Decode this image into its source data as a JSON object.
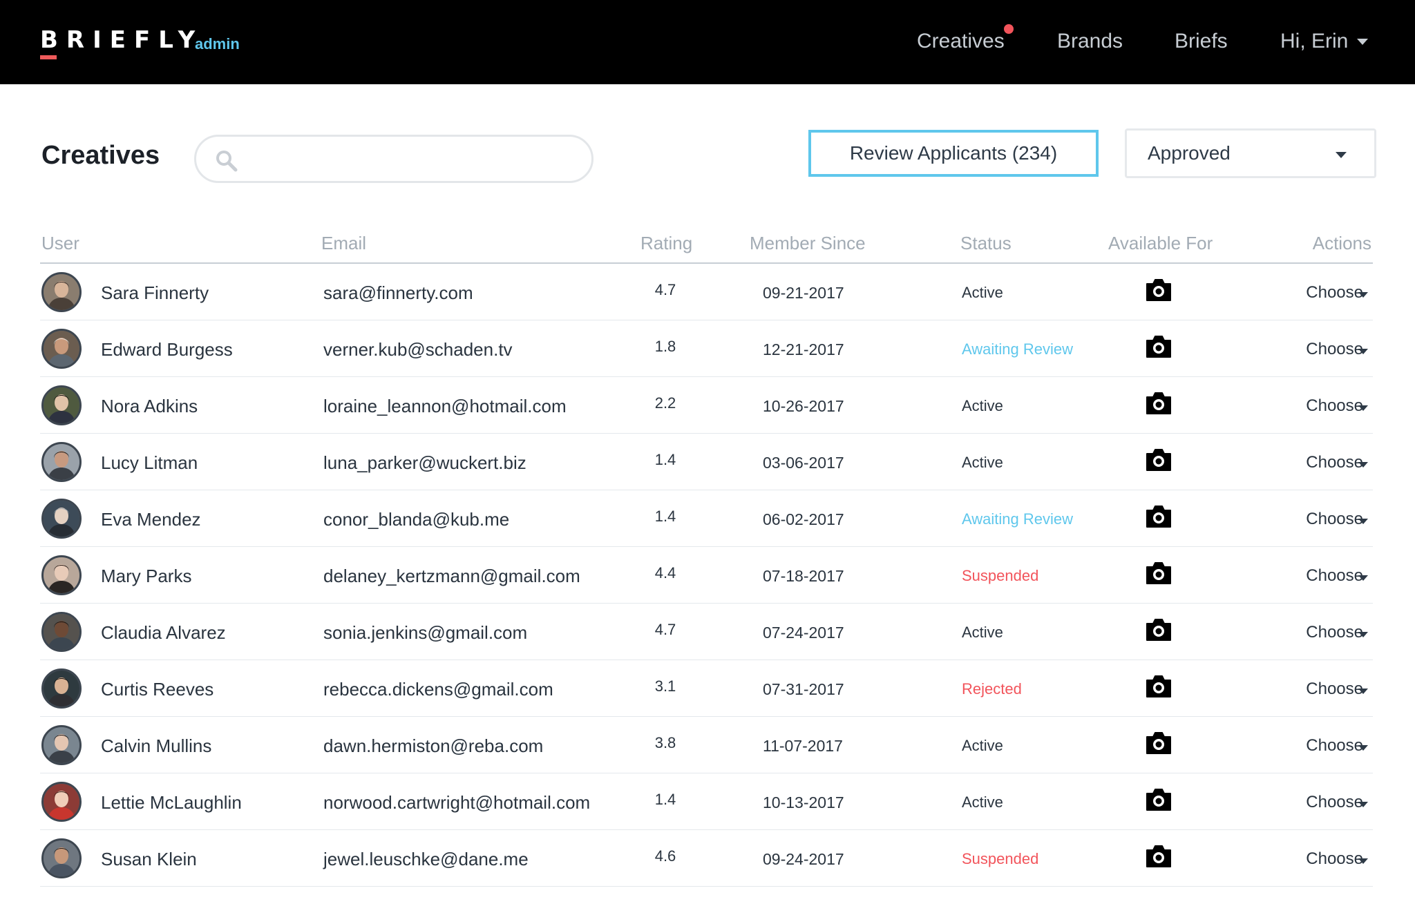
{
  "brand": {
    "name": "BRIEFLY",
    "sub": "admin",
    "accent": "#ef5b5b",
    "sub_color": "#5fc7ec"
  },
  "nav": {
    "items": [
      {
        "label": "Creatives",
        "has_notification": true
      },
      {
        "label": "Brands"
      },
      {
        "label": "Briefs"
      }
    ],
    "user_label": "Hi, Erin"
  },
  "page": {
    "title": "Creatives",
    "search": {
      "value": "",
      "placeholder": "",
      "icon": "search-icon"
    },
    "review_button_label": "Review Applicants (234)",
    "filter": {
      "selected": "Approved"
    }
  },
  "table": {
    "columns": [
      "User",
      "Email",
      "Rating",
      "Member Since",
      "Status",
      "Available For",
      "Actions"
    ],
    "status_colors": {
      "Active": "#2a343f",
      "Awaiting Review": "#5fc7ec",
      "Suspended": "#f2545b",
      "Rejected": "#f2545b"
    },
    "available_icon": "camera-icon",
    "rows": [
      {
        "name": "Sara Finnerty",
        "email": "sara@finnerty.com",
        "rating": "4.7",
        "member_since": "09-21-2017",
        "status": "Active",
        "action": "Choose"
      },
      {
        "name": "Edward Burgess",
        "email": "verner.kub@schaden.tv",
        "rating": "1.8",
        "member_since": "12-21-2017",
        "status": "Awaiting Review",
        "action": "Choose"
      },
      {
        "name": "Nora Adkins",
        "email": "loraine_leannon@hotmail.com",
        "rating": "2.2",
        "member_since": "10-26-2017",
        "status": "Active",
        "action": "Choose"
      },
      {
        "name": "Lucy Litman",
        "email": "luna_parker@wuckert.biz",
        "rating": "1.4",
        "member_since": "03-06-2017",
        "status": "Active",
        "action": "Choose"
      },
      {
        "name": "Eva Mendez",
        "email": "conor_blanda@kub.me",
        "rating": "1.4",
        "member_since": "06-02-2017",
        "status": "Awaiting Review",
        "action": "Choose"
      },
      {
        "name": "Mary Parks",
        "email": "delaney_kertzmann@gmail.com",
        "rating": "4.4",
        "member_since": "07-18-2017",
        "status": "Suspended",
        "action": "Choose"
      },
      {
        "name": "Claudia Alvarez",
        "email": "sonia.jenkins@gmail.com",
        "rating": "4.7",
        "member_since": "07-24-2017",
        "status": "Active",
        "action": "Choose"
      },
      {
        "name": "Curtis Reeves",
        "email": "rebecca.dickens@gmail.com",
        "rating": "3.1",
        "member_since": "07-31-2017",
        "status": "Rejected",
        "action": "Choose"
      },
      {
        "name": "Calvin Mullins",
        "email": "dawn.hermiston@reba.com",
        "rating": "3.8",
        "member_since": "11-07-2017",
        "status": "Active",
        "action": "Choose"
      },
      {
        "name": "Lettie McLaughlin",
        "email": "norwood.cartwright@hotmail.com",
        "rating": "1.4",
        "member_since": "10-13-2017",
        "status": "Active",
        "action": "Choose"
      },
      {
        "name": "Susan Klein",
        "email": "jewel.leuschke@dane.me",
        "rating": "4.6",
        "member_since": "09-24-2017",
        "status": "Suspended",
        "action": "Choose"
      }
    ]
  }
}
